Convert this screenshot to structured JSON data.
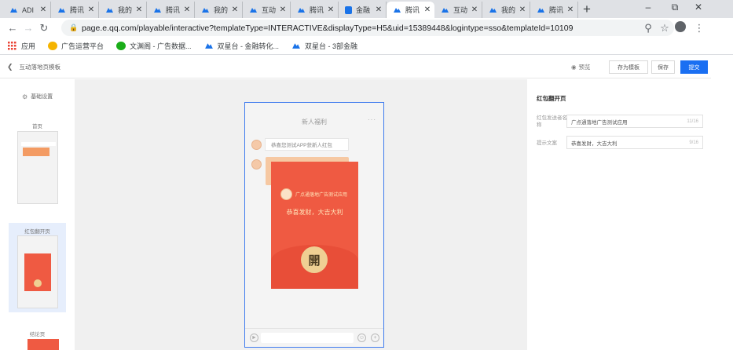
{
  "browser": {
    "tabs": [
      {
        "label": "ADI",
        "icon": "ad-icon"
      },
      {
        "label": "腾讯",
        "icon": "ad-icon"
      },
      {
        "label": "我的",
        "icon": "ad-icon"
      },
      {
        "label": "腾讯",
        "icon": "ad-icon"
      },
      {
        "label": "我的",
        "icon": "ad-icon"
      },
      {
        "label": "互动",
        "icon": "ad-icon"
      },
      {
        "label": "腾讯",
        "icon": "ad-icon"
      },
      {
        "label": "金融",
        "icon": "doc-icon"
      },
      {
        "label": "腾讯",
        "icon": "ad-icon",
        "active": true
      },
      {
        "label": "互动",
        "icon": "ad-icon"
      },
      {
        "label": "我的",
        "icon": "ad-icon"
      },
      {
        "label": "腾讯",
        "icon": "headset-icon"
      }
    ],
    "new_tab": "+",
    "window_controls": {
      "minimize": "–",
      "restore": "⧉",
      "close": "✕"
    },
    "url": "page.e.qq.com/playable/interactive?templateType=INTERACTIVE&displayType=H5&uid=15389448&logintype=sso&templateId=10109",
    "bookmarks": [
      {
        "label": "应用",
        "icon": "apps-grid-icon"
      },
      {
        "label": "广告运营平台",
        "icon": "leaf-icon"
      },
      {
        "label": "文渊阁 - 广告数据...",
        "icon": "wechat-icon"
      },
      {
        "label": "双星台 - 金融转化...",
        "icon": "ad-icon"
      },
      {
        "label": "双星台 - 3部金融",
        "icon": "ad-icon"
      }
    ]
  },
  "header": {
    "title": "互动落地页模板",
    "preview": "预览",
    "save_as_template": "存为模板",
    "save": "保存",
    "submit": "提交"
  },
  "left_panel": {
    "settings": "基础设置",
    "pages": [
      {
        "label": "首页"
      },
      {
        "label": "红包翻开页"
      },
      {
        "label": "结论页"
      }
    ]
  },
  "phone": {
    "title": "新人福利",
    "more": "···",
    "bubble_text": "恭喜您测试APP获新人红包",
    "packet_sender": "广点通落地广告测试应用",
    "packet_wish": "恭喜发财，大吉大利",
    "open_char": "開"
  },
  "right_panel": {
    "title": "红包翻开页",
    "fields": [
      {
        "label": "红包发送者名称",
        "value": "广点通落地广告测试应用",
        "count": "11/16"
      },
      {
        "label": "提示文案",
        "value": "恭喜发财，大吉大利",
        "count": "9/16"
      }
    ]
  },
  "colors": {
    "accent": "#1a6ff2",
    "packet_red": "#ef5a42",
    "packet_gold": "#efcf93"
  }
}
